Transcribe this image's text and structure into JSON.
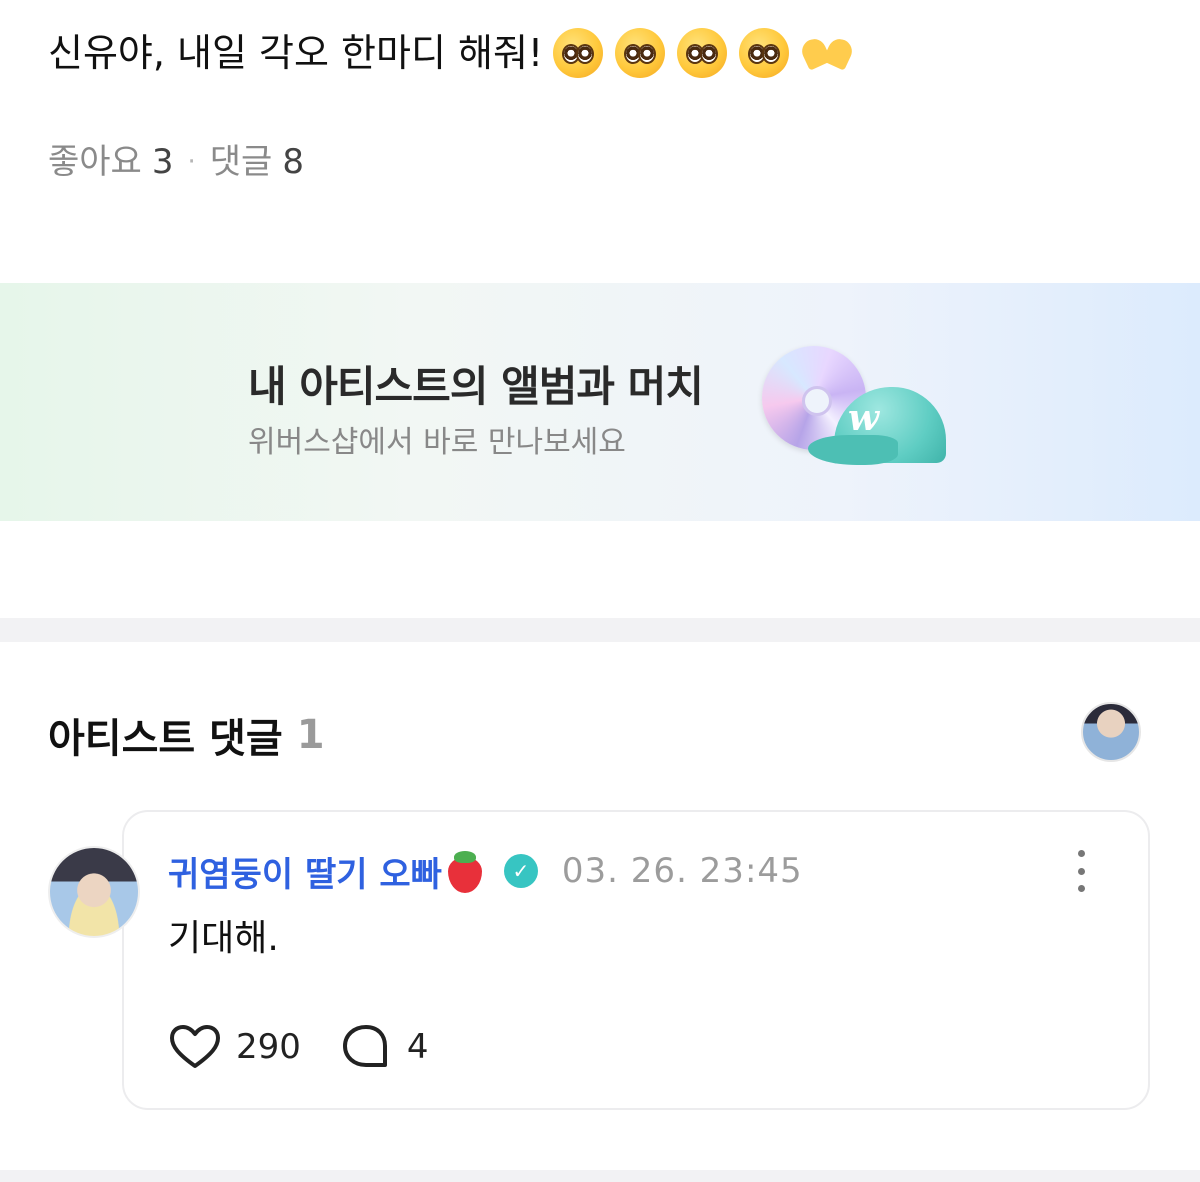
{
  "post": {
    "text": "신유야, 내일 각오 한마디 해줘!",
    "emojis": [
      "pleading-face",
      "pleading-face",
      "pleading-face",
      "pleading-face",
      "heart-hands"
    ]
  },
  "stats": {
    "likes_label": "좋아요",
    "likes_count": "3",
    "separator": "·",
    "comments_label": "댓글",
    "comments_count": "8"
  },
  "banner": {
    "title": "내 아티스트의 앨범과 머치",
    "subtitle": "위버스샵에서 바로 만나보세요",
    "cap_logo": "w"
  },
  "artist_comments": {
    "title": "아티스트 댓글",
    "count": "1"
  },
  "comment": {
    "author": "귀염둥이 딸기 오빠",
    "author_emoji": "strawberry",
    "verified_mark": "✓",
    "date": "03. 26. 23:45",
    "body": "기대해.",
    "like_count": "290",
    "reply_count": "4"
  },
  "colors": {
    "author_blue": "#2f61e0",
    "verified_teal": "#37c5c2",
    "muted_gray": "#9c9c9c"
  }
}
